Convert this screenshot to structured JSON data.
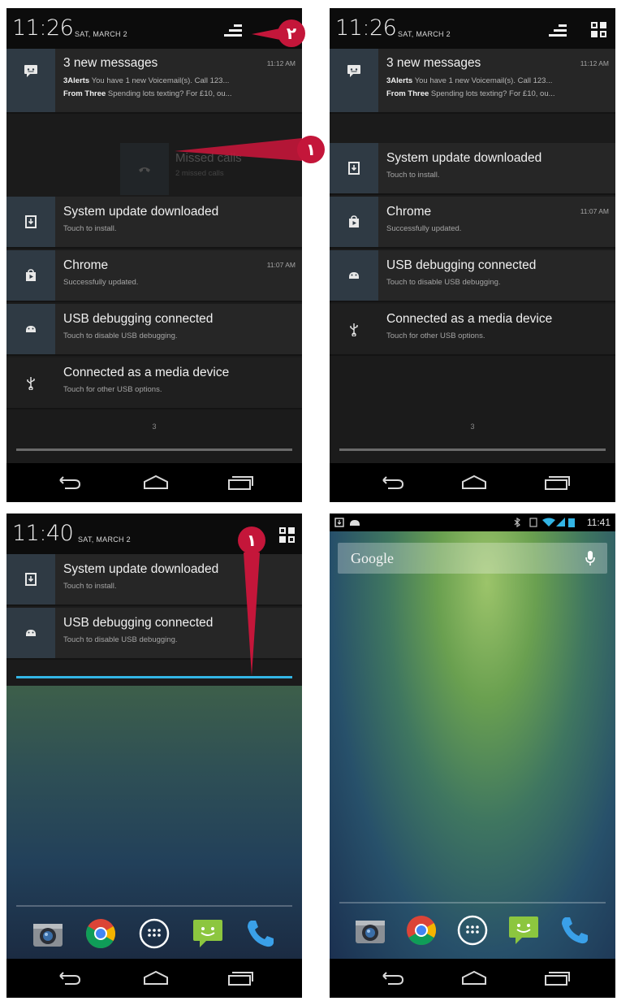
{
  "panel1": {
    "clock": "11:26",
    "date": "SAT, MARCH 2",
    "messages": {
      "title": "3 new messages",
      "time": "11:12 AM",
      "line1_sender": "3Alerts",
      "line1_text": "You have 1 new Voicemail(s). Call 123...",
      "line2_sender": "From Three",
      "line2_text": "Spending lots texting? For £10, ou..."
    },
    "ghost": {
      "title": "Missed calls",
      "sub": "2 missed calls"
    },
    "items": [
      {
        "title": "System update downloaded",
        "sub": "Touch to install.",
        "time": ""
      },
      {
        "title": "Chrome",
        "sub": "Successfully updated.",
        "time": "11:07 AM"
      },
      {
        "title": "USB debugging connected",
        "sub": "Touch to disable USB debugging.",
        "time": ""
      },
      {
        "title": "Connected as a media device",
        "sub": "Touch for other USB options.",
        "time": ""
      }
    ],
    "count": "3",
    "badge_clear": "٢",
    "badge_swipe": "١"
  },
  "panel2": {
    "clock": "11:26",
    "date": "SAT, MARCH 2",
    "messages": {
      "title": "3 new messages",
      "time": "11:12 AM",
      "line1_sender": "3Alerts",
      "line1_text": "You have 1 new Voicemail(s). Call 123...",
      "line2_sender": "From Three",
      "line2_text": "Spending lots texting? For £10, ou..."
    },
    "items": [
      {
        "title": "System update downloaded",
        "sub": "Touch to install.",
        "time": ""
      },
      {
        "title": "Chrome",
        "sub": "Successfully updated.",
        "time": "11:07 AM"
      },
      {
        "title": "USB debugging connected",
        "sub": "Touch to disable USB debugging.",
        "time": ""
      },
      {
        "title": "Connected as a media device",
        "sub": "Touch for other USB options.",
        "time": ""
      }
    ],
    "count": "3"
  },
  "panel3": {
    "clock": "11:40",
    "date": "SAT, MARCH 2",
    "items": [
      {
        "title": "System update downloaded",
        "sub": "Touch to install."
      },
      {
        "title": "USB debugging connected",
        "sub": "Touch to disable USB debugging."
      }
    ],
    "badge_drag": "١"
  },
  "panel4": {
    "status_time": "11:41",
    "search_logo": "Google"
  },
  "colors": {
    "callout": "#c4163a",
    "handle_blue": "#33b5e5",
    "icon_box": "#2f3a44"
  },
  "icons": [
    "message-icon",
    "download-icon",
    "play-store-icon",
    "android-icon",
    "usb-icon",
    "missed-call-icon",
    "clear-all-icon",
    "quick-settings-icon",
    "back-icon",
    "home-icon",
    "recent-apps-icon",
    "camera-icon",
    "chrome-icon",
    "app-drawer-icon",
    "messaging-icon",
    "phone-icon",
    "mic-icon"
  ]
}
